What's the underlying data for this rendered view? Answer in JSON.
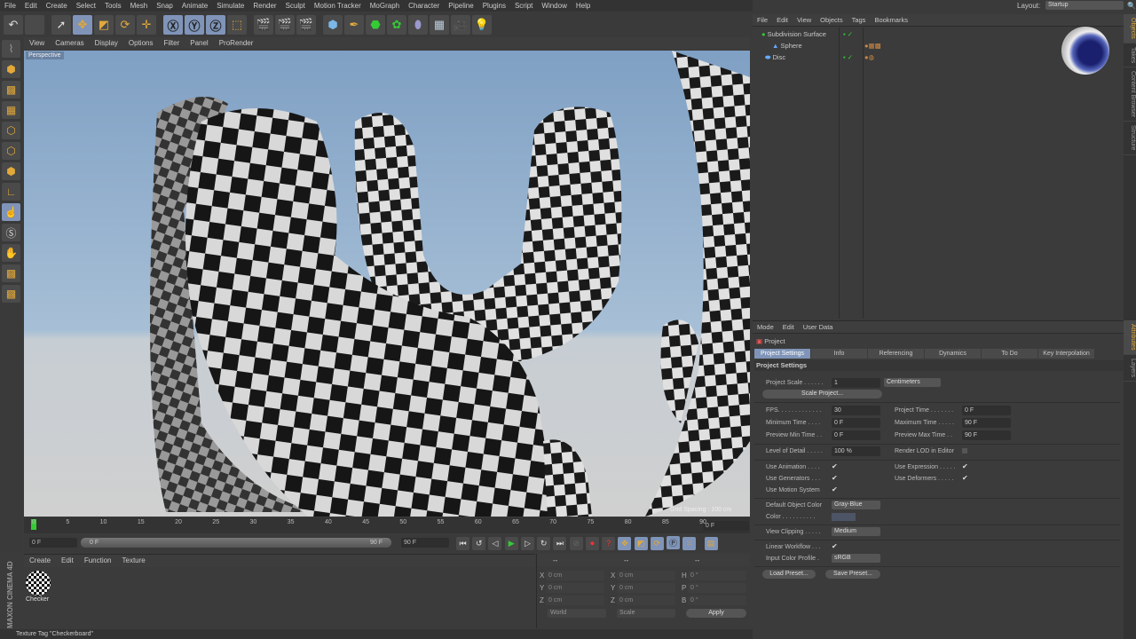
{
  "menu": [
    "File",
    "Edit",
    "Create",
    "Select",
    "Tools",
    "Mesh",
    "Snap",
    "Animate",
    "Simulate",
    "Render",
    "Sculpt",
    "Motion Tracker",
    "MoGraph",
    "Character",
    "Pipeline",
    "Plugins",
    "Script",
    "Window",
    "Help"
  ],
  "layout": {
    "label": "Layout:",
    "value": "Startup"
  },
  "viewport": {
    "menu": [
      "View",
      "Cameras",
      "Display",
      "Options",
      "Filter",
      "Panel",
      "ProRender"
    ],
    "camera": "Perspective",
    "grid_spacing": "Grid Spacing : 100 cm"
  },
  "timeline": {
    "ticks": [
      "0",
      "5",
      "10",
      "15",
      "20",
      "25",
      "30",
      "35",
      "40",
      "45",
      "50",
      "55",
      "60",
      "65",
      "70",
      "75",
      "80",
      "85",
      "90"
    ],
    "current": "0 F",
    "start": "0 F",
    "range_start": "0 F",
    "range_end": "90 F",
    "end": "90 F"
  },
  "material_manager": {
    "menu": [
      "Create",
      "Edit",
      "Function",
      "Texture"
    ],
    "materials": [
      {
        "name": "Checker"
      }
    ]
  },
  "coordinates": {
    "header": [
      "--",
      "--",
      "--"
    ],
    "rows": [
      [
        "X",
        "0 cm",
        "X",
        "0 cm",
        "H",
        "0 °"
      ],
      [
        "Y",
        "0 cm",
        "Y",
        "0 cm",
        "P",
        "0 °"
      ],
      [
        "Z",
        "0 cm",
        "Z",
        "0 cm",
        "B",
        "0 °"
      ]
    ],
    "mode": "World",
    "size_mode": "Scale",
    "apply": "Apply"
  },
  "status": "Texture Tag \"Checkerboard\"",
  "brand": "MAXON CINEMA 4D",
  "object_manager": {
    "menu": [
      "File",
      "Edit",
      "View",
      "Objects",
      "Tags",
      "Bookmarks"
    ],
    "objects": [
      {
        "name": "Subdivision Surface"
      },
      {
        "name": "Sphere"
      },
      {
        "name": "Disc"
      }
    ]
  },
  "right_tabs_top": [
    "Objects",
    "Takes",
    "Content Browser",
    "Structure"
  ],
  "right_tabs_bottom": [
    "Attributes",
    "Layers"
  ],
  "attributes": {
    "menu": [
      "Mode",
      "Edit",
      "User Data"
    ],
    "object": "Project",
    "tabs": [
      "Project Settings",
      "Info",
      "Referencing",
      "Dynamics",
      "To Do",
      "Key Interpolation"
    ],
    "section": "Project Settings",
    "project_scale_label": "Project Scale . . . . . .",
    "project_scale": "1",
    "units": "Centimeters",
    "scale_project": "Scale Project...",
    "fps_label": "FPS. . . . . . . . . . . . .",
    "fps": "30",
    "project_time_label": "Project Time . . . . . . .",
    "project_time": "0 F",
    "min_time_label": "Minimum Time . . . .",
    "min_time": "0 F",
    "max_time_label": "Maximum Time . . . . .",
    "max_time": "90 F",
    "prev_min_label": "Preview Min Time . .",
    "prev_min": "0 F",
    "prev_max_label": "Preview Max Time . .",
    "prev_max": "90 F",
    "lod_label": "Level of Detail . . . . .",
    "lod": "100 %",
    "render_lod_label": "Render LOD in Editor",
    "use_animation": "Use Animation . . . .",
    "use_expression": "Use Expression . . . . .",
    "use_generators": "Use Generators . . .",
    "use_deformers": "Use Deformers . . . . .",
    "use_motion": "Use Motion System",
    "default_color_label": "Default Object Color",
    "default_color": "Gray-Blue",
    "color_label": "Color . . . . . . . . . .",
    "view_clipping_label": "View Clipping . . . . .",
    "view_clipping": "Medium",
    "linear_workflow": "Linear Workflow . . .",
    "input_profile_label": "Input Color Profile .",
    "input_profile": "sRGB",
    "load_preset": "Load Preset...",
    "save_preset": "Save Preset..."
  }
}
